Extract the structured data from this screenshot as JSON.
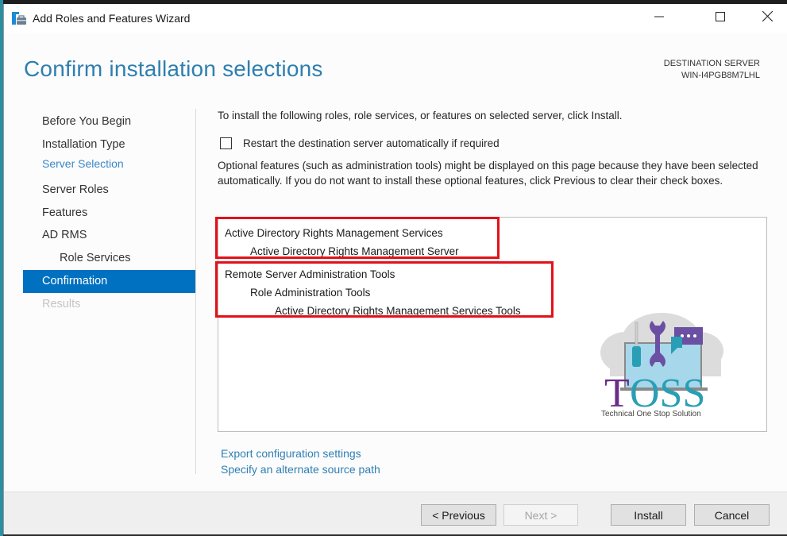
{
  "window": {
    "title": "Add Roles and Features Wizard",
    "controls": {
      "minimize_icon": "minimize-icon",
      "maximize_icon": "maximize-icon",
      "close_icon": "close-icon"
    }
  },
  "header": {
    "page_title": "Confirm installation selections",
    "destination_label": "DESTINATION SERVER",
    "destination_server": "WIN-I4PGB8M7LHL"
  },
  "sidebar": {
    "items": [
      {
        "label": "Before You Begin",
        "state": "normal"
      },
      {
        "label": "Installation Type",
        "state": "normal"
      },
      {
        "label": "Server Selection",
        "state": "link"
      },
      {
        "label": "Server Roles",
        "state": "normal"
      },
      {
        "label": "Features",
        "state": "normal"
      },
      {
        "label": "AD RMS",
        "state": "normal"
      },
      {
        "label": "Role Services",
        "state": "sub"
      },
      {
        "label": "Confirmation",
        "state": "active"
      },
      {
        "label": "Results",
        "state": "disabled"
      }
    ]
  },
  "main": {
    "intro": "To install the following roles, role services, or features on selected server, click Install.",
    "restart_checkbox": {
      "label": "Restart the destination server automatically if required",
      "checked": false
    },
    "optional_note": "Optional features (such as administration tools) might be displayed on this page because they have been selected automatically. If you do not want to install these optional features, click Previous to clear their check boxes.",
    "selections": [
      {
        "label": "Active Directory Rights Management Services",
        "level": 0
      },
      {
        "label": "Active Directory Rights Management Server",
        "level": 1
      },
      {
        "label": "Remote Server Administration Tools",
        "level": 0
      },
      {
        "label": "Role Administration Tools",
        "level": 1
      },
      {
        "label": "Active Directory Rights Management Services Tools",
        "level": 2
      }
    ],
    "links": {
      "export": "Export configuration settings",
      "alternate_source": "Specify an alternate source path"
    },
    "watermark": {
      "title": "TOSS",
      "subtitle": "Technical One Stop Solution"
    }
  },
  "footer": {
    "previous": "< Previous",
    "next": "Next >",
    "install": "Install",
    "cancel": "Cancel"
  },
  "colors": {
    "accent": "#0070c0",
    "title": "#2e7fb0",
    "link": "#2f7fb3",
    "highlight": "#e3101a"
  }
}
